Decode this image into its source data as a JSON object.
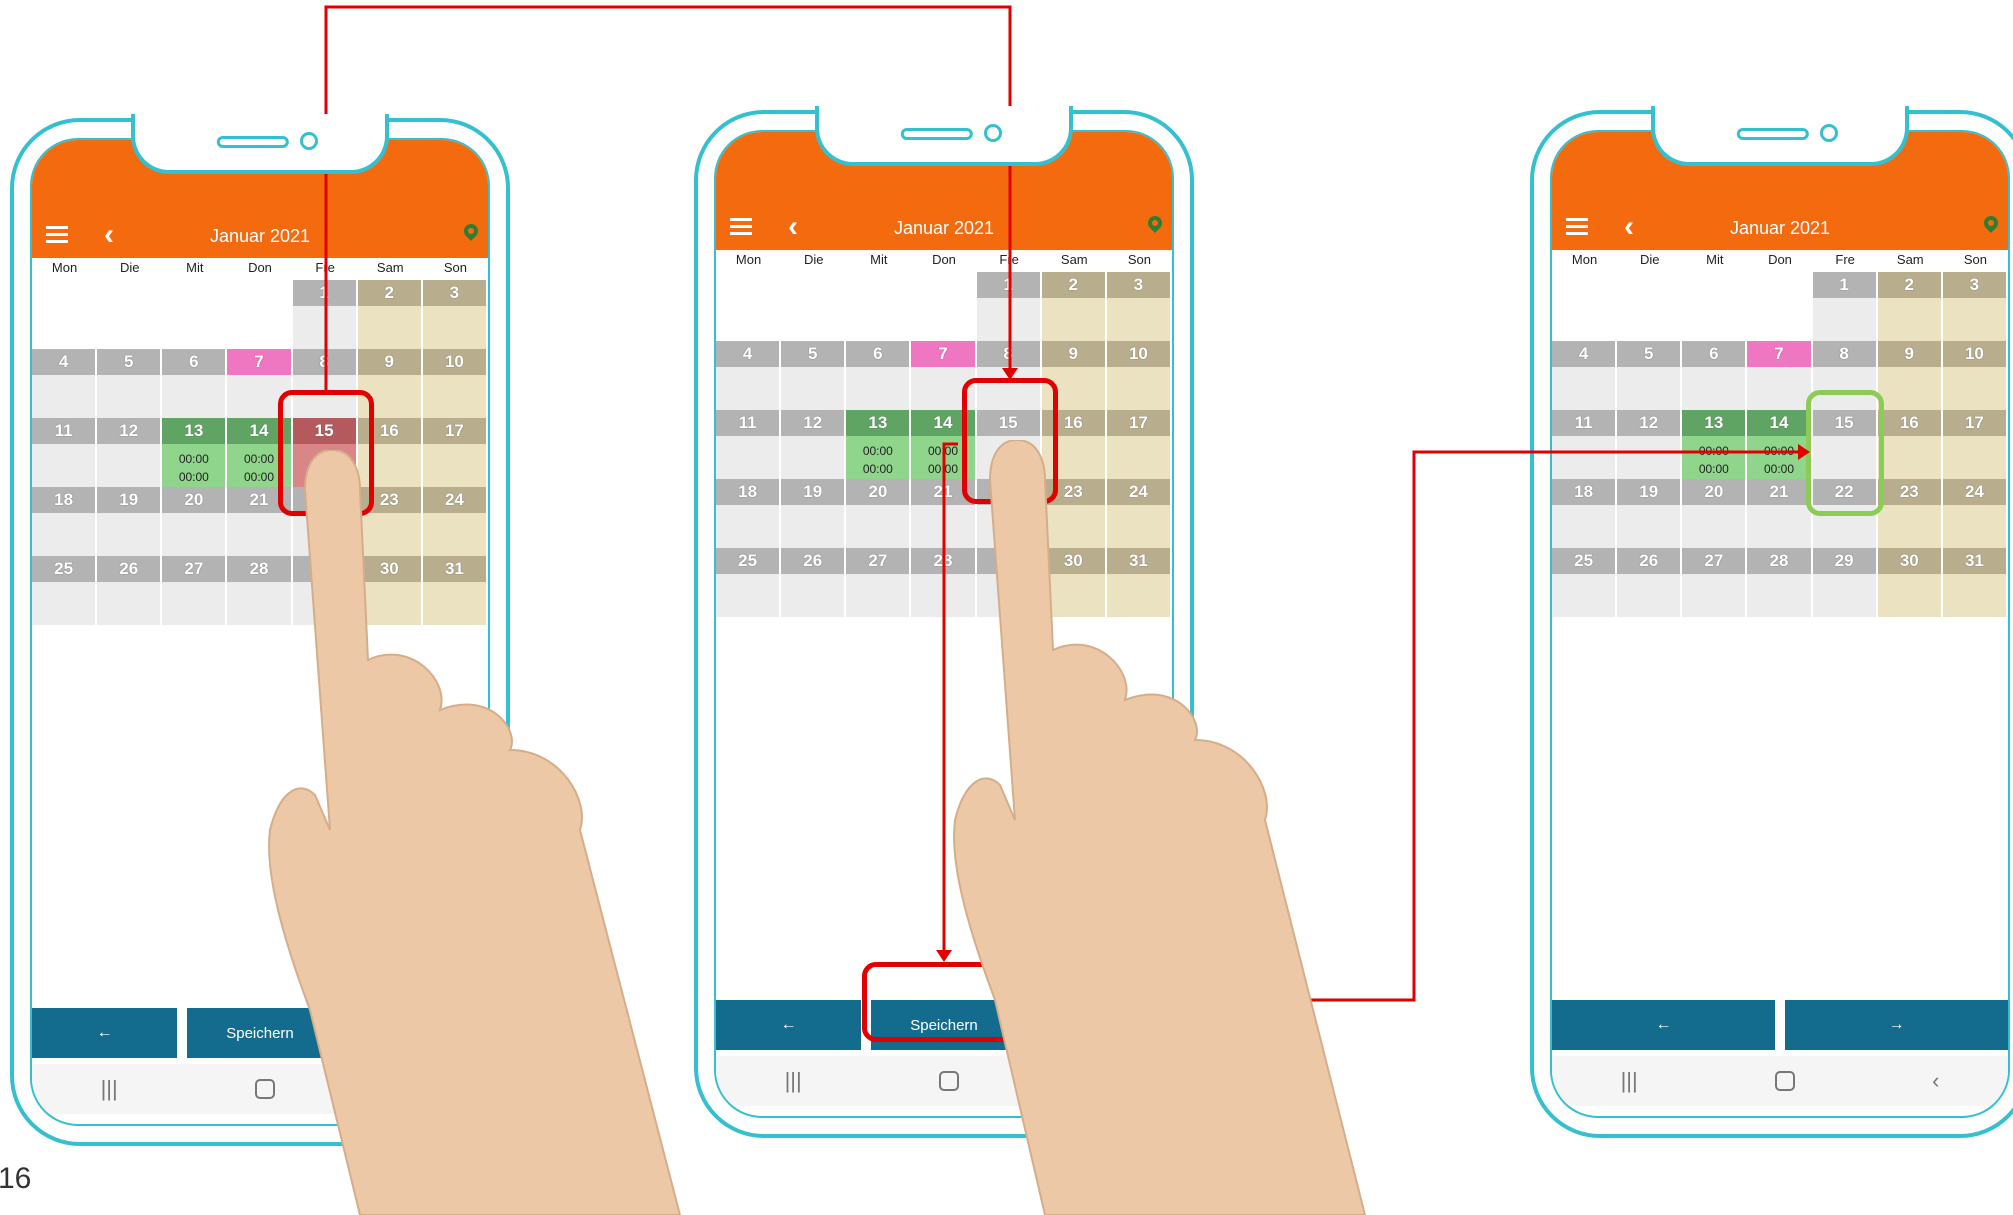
{
  "page_number": "16",
  "app": {
    "month_title": "Januar 2021",
    "weekdays": [
      "Mon",
      "Die",
      "Mit",
      "Don",
      "Fre",
      "Sam",
      "Son"
    ],
    "save_label": "Speichern",
    "time_entry": [
      "00:00",
      "00:00"
    ]
  },
  "weeks": [
    [
      {
        "d": ""
      },
      {
        "d": ""
      },
      {
        "d": ""
      },
      {
        "d": ""
      },
      {
        "d": "1"
      },
      {
        "d": "2",
        "t": "weekend"
      },
      {
        "d": "3",
        "t": "weekend"
      }
    ],
    [
      {
        "d": "4"
      },
      {
        "d": "5"
      },
      {
        "d": "6"
      },
      {
        "d": "7",
        "t": "holiday"
      },
      {
        "d": "8"
      },
      {
        "d": "9",
        "t": "weekend"
      },
      {
        "d": "10",
        "t": "weekend"
      }
    ],
    [
      {
        "d": "11"
      },
      {
        "d": "12"
      },
      {
        "d": "13",
        "t": "worked"
      },
      {
        "d": "14",
        "t": "worked"
      },
      {
        "d": "15",
        "t": "target"
      },
      {
        "d": "16",
        "t": "weekend"
      },
      {
        "d": "17",
        "t": "weekend"
      }
    ],
    [
      {
        "d": "18"
      },
      {
        "d": "19"
      },
      {
        "d": "20"
      },
      {
        "d": "21"
      },
      {
        "d": "22"
      },
      {
        "d": "23",
        "t": "weekend"
      },
      {
        "d": "24",
        "t": "weekend"
      }
    ],
    [
      {
        "d": "25"
      },
      {
        "d": "26"
      },
      {
        "d": "27"
      },
      {
        "d": "28"
      },
      {
        "d": "29"
      },
      {
        "d": "30",
        "t": "weekend"
      },
      {
        "d": "31",
        "t": "weekend"
      }
    ]
  ],
  "icons": {
    "menu": "hamburger-menu-icon",
    "back": "chevron-left-icon",
    "location": "location-pin-icon",
    "prev": "arrow-left-icon",
    "next": "arrow-right-icon"
  },
  "colors": {
    "appbar": "#f46a0e",
    "frame": "#35c0cf",
    "button": "#136c8e",
    "worked": "#8fd58b",
    "weekend": "#ebe2c2",
    "holiday": "#ef76c1",
    "selected": "#d98688",
    "highlight_red": "#e00000",
    "highlight_green": "#8ccb56"
  },
  "phones": [
    {
      "id": "phone-1",
      "step": "select",
      "target_state": "selected",
      "buttons": [
        "prev",
        "save",
        "next"
      ]
    },
    {
      "id": "phone-2",
      "step": "save",
      "target_state": "plain",
      "buttons": [
        "prev",
        "save",
        "next"
      ]
    },
    {
      "id": "phone-3",
      "step": "result",
      "target_state": "plain",
      "buttons": [
        "prev",
        "next"
      ]
    }
  ]
}
